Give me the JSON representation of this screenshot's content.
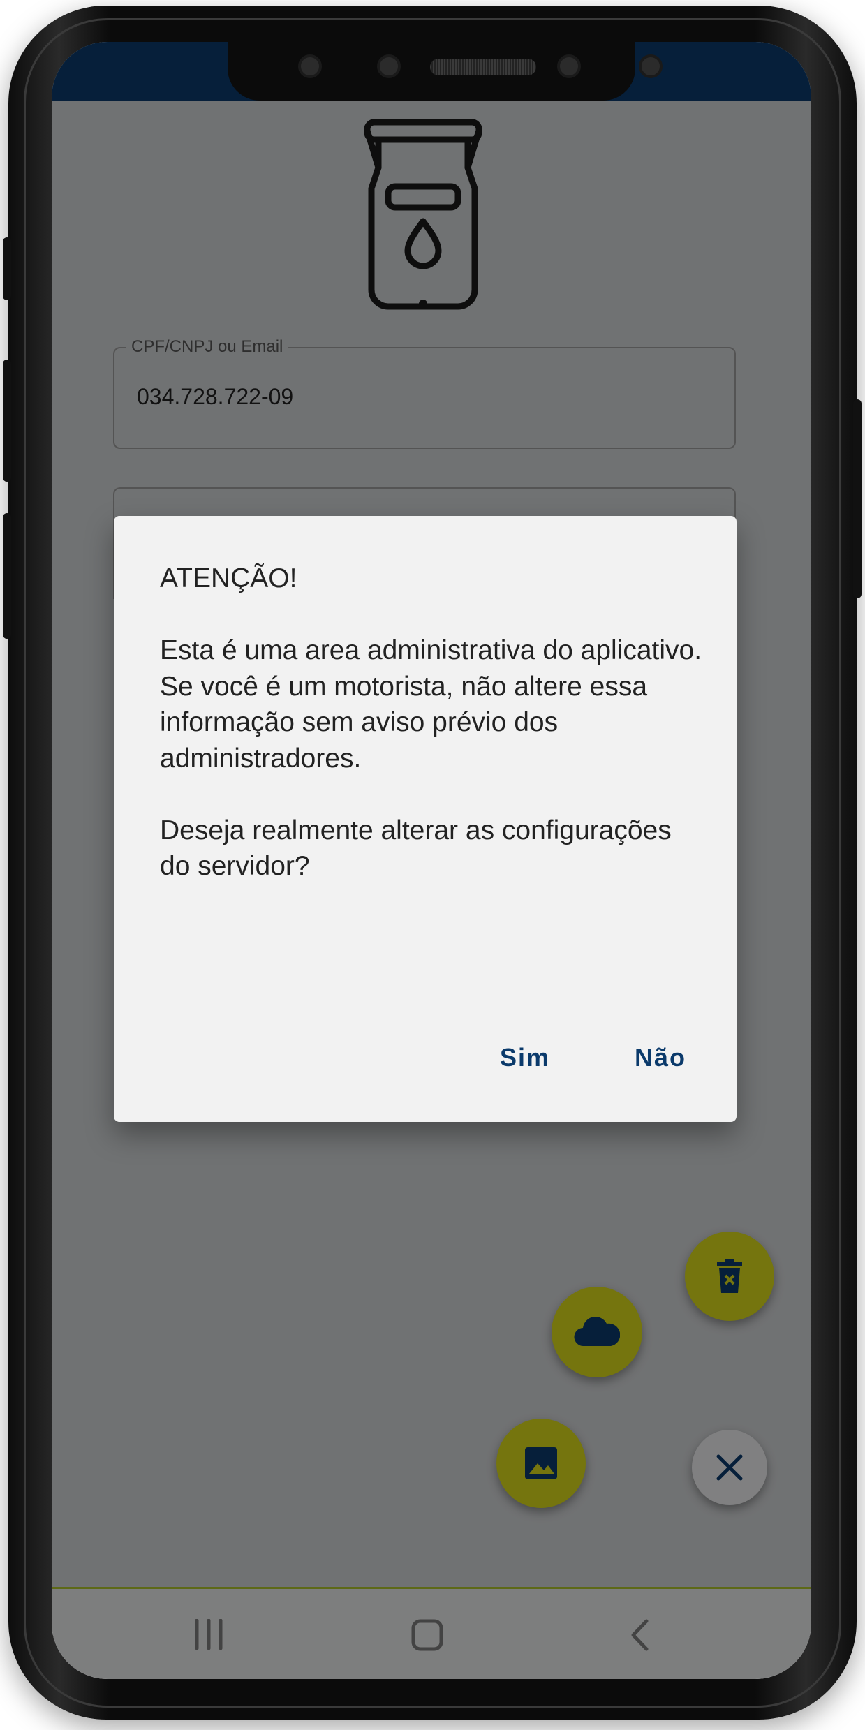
{
  "login_form": {
    "user_field": {
      "label": "CPF/CNPJ ou Email",
      "value": "034.728.722-09"
    }
  },
  "dialog": {
    "title": "ATENÇÃO!",
    "message_line_1": "Esta é uma area administrativa do aplicativo.",
    "message_line_2": "Se você é um motorista, não altere essa informação sem aviso prévio dos administradores.",
    "question": "Deseja realmente alterar as configurações do servidor?",
    "confirm_label": "Sim",
    "cancel_label": "Não"
  },
  "fab_menu": {
    "items": [
      {
        "icon": "trash-icon"
      },
      {
        "icon": "cloud-icon"
      },
      {
        "icon": "image-icon"
      },
      {
        "icon": "close-icon"
      }
    ]
  },
  "nav_bar": {
    "icons": [
      "recent-apps-icon",
      "home-icon",
      "back-icon"
    ]
  },
  "colors": {
    "primary": "#0b3a6b",
    "accent": "#d6d61a",
    "accent_line": "#a9c02b",
    "dialog_bg": "#f2f2f2"
  }
}
